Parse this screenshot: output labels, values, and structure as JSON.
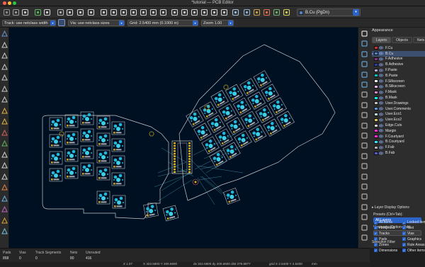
{
  "window": {
    "title": "*tutorial — PCB Editor"
  },
  "toolbar": {
    "layer_select": "B.Cu (PgDn)",
    "layer_color": "#4d7fc4",
    "icons": [
      "board-setup-icon",
      "page-settings-icon",
      "save-icon",
      "netlist-icon",
      "print-icon",
      "plot-icon",
      "undo-icon",
      "redo-icon",
      "find-icon",
      "refresh-icon",
      "zoom-in-icon",
      "zoom-out-icon",
      "zoom-fit-icon",
      "zoom-objects-icon",
      "zoom-selection-icon",
      "rotate-ccw-icon",
      "rotate-cw-icon",
      "flip-icon",
      "mirror-icon",
      "group-icon",
      "lock-icon",
      "unlock-icon",
      "footprint-editor-icon",
      "footprint-browser-icon",
      "update-pcb-icon",
      "drc-icon",
      "3d-viewer-icon",
      "scripting-icon"
    ]
  },
  "toolbar2": {
    "track": "Track: use netclass width",
    "via": "Via: use netclass sizes",
    "grid": "Grid: 2.5400 mm (0.1000 in)",
    "zoom": "Zoom 1.00"
  },
  "appearance": {
    "title": "Appearance",
    "tabs": [
      "Layers",
      "Objects",
      "Nets"
    ],
    "layers": [
      {
        "name": "F.Cu",
        "color": "#c83434"
      },
      {
        "name": "B.Cu",
        "color": "#4d7fc4",
        "selected": true
      },
      {
        "name": "F.Adhesive",
        "color": "#8a2e8a"
      },
      {
        "name": "B.Adhesive",
        "color": "#2f3fa8"
      },
      {
        "name": "F.Paste",
        "color": "#b4a8d0"
      },
      {
        "name": "B.Paste",
        "color": "#00c2c2"
      },
      {
        "name": "F.Silkscreen",
        "color": "#f0f0f0"
      },
      {
        "name": "B.Silkscreen",
        "color": "#e8b0f0"
      },
      {
        "name": "F.Mask",
        "color": "#d880c8"
      },
      {
        "name": "B.Mask",
        "color": "#02ffee"
      },
      {
        "name": "User.Drawings",
        "color": "#c2c2c2"
      },
      {
        "name": "User.Comments",
        "color": "#5994dc"
      },
      {
        "name": "User.Eco1",
        "color": "#b4dbd2"
      },
      {
        "name": "User.Eco2",
        "color": "#d8c852"
      },
      {
        "name": "Edge.Cuts",
        "color": "#d0d2cd"
      },
      {
        "name": "Margin",
        "color": "#ff26e2"
      },
      {
        "name": "F.Courtyard",
        "color": "#ff26e2"
      },
      {
        "name": "B.Courtyard",
        "color": "#26e9ff"
      },
      {
        "name": "F.Fab",
        "color": "#afafaf"
      },
      {
        "name": "B.Fab",
        "color": "#5858d0"
      }
    ],
    "layer_display_options": "Layer Display Options",
    "presets_label": "Presets (Ctrl+Tab):",
    "presets_value": "All Layers",
    "viewports_label": "Viewports (Option+Tab):",
    "selection_filter": "Selection Filter",
    "filter_items": [
      "All items",
      "Locked items",
      "Footprints",
      "Text",
      "Tracks",
      "Vias",
      "Pads",
      "Graphics",
      "Zones",
      "Rule Areas",
      "Dimensions",
      "Other items"
    ]
  },
  "status": {
    "pads_label": "Pads",
    "pads_value": "858",
    "vias_label": "Vias",
    "vias_value": "0",
    "track_label": "Track Segments",
    "track_value": "0",
    "nets_label": "Nets",
    "nets_value": "80",
    "unrouted_label": "Unrouted",
    "unrouted_value": "416"
  },
  "coords": {
    "z": "Z 1.07",
    "xy": "X 322.5800  Y 200.6600",
    "dxdy": "dx 322.5800  dy 200.6600  dist 379.8977",
    "grid": "grid X 2.5400  Y 2.5400",
    "units": "mm"
  }
}
